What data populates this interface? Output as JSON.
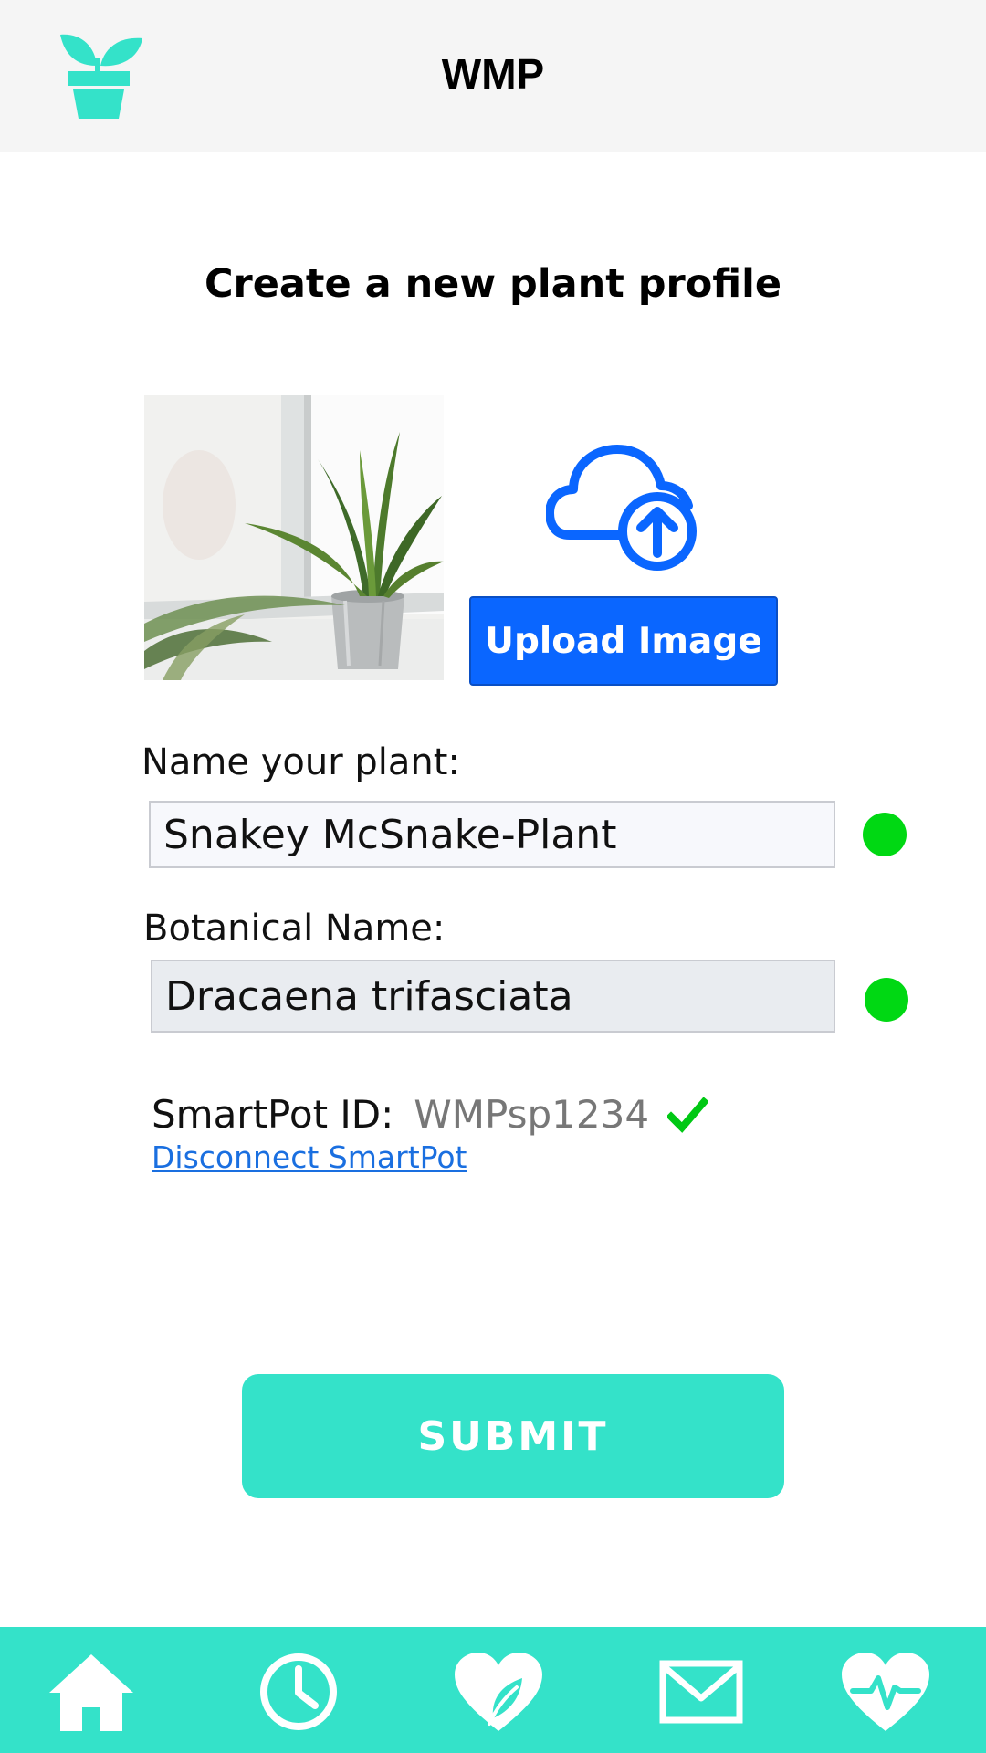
{
  "header": {
    "app_title": "WMP",
    "logo_icon": "plant-pot-icon"
  },
  "main": {
    "page_title": "Create a new plant profile",
    "upload_button_label": "Upload Image",
    "upload_icon": "cloud-upload-icon",
    "name_label": "Name your plant:",
    "name_value": "Snakey McSnake-Plant",
    "botanical_label": "Botanical Name:",
    "botanical_value": "Dracaena trifasciata",
    "smartpot_label": "SmartPot ID:",
    "smartpot_id": "WMPsp1234",
    "disconnect_link": "Disconnect SmartPot",
    "submit_label": "SUBMIT"
  },
  "bottom_nav": {
    "items": [
      {
        "icon": "home-icon"
      },
      {
        "icon": "clock-icon"
      },
      {
        "icon": "heart-leaf-icon"
      },
      {
        "icon": "mail-icon"
      },
      {
        "icon": "heartbeat-icon"
      }
    ]
  },
  "colors": {
    "accent": "#34e2c9",
    "upload_blue": "#0a66ff",
    "status_green": "#00d813",
    "link_blue": "#1a6fe0"
  }
}
